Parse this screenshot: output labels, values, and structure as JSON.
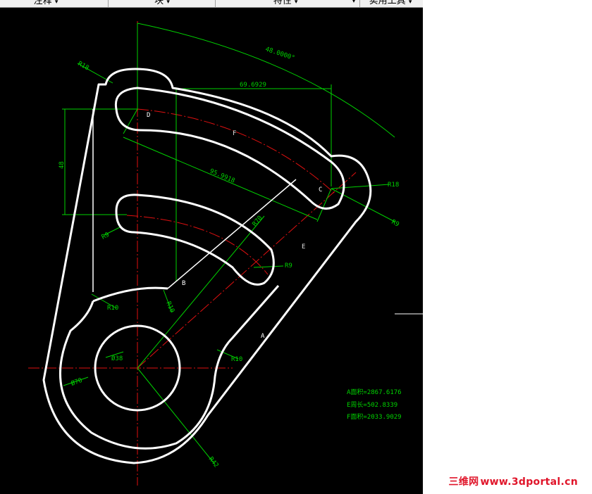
{
  "toolbar": {
    "items": [
      "注释",
      "块",
      "特性",
      "实用工具"
    ],
    "dropdown_glyph": "▾"
  },
  "drawing": {
    "points": {
      "a": "A",
      "b": "B",
      "c": "C",
      "d": "D",
      "e": "E",
      "f": "F"
    },
    "dims": {
      "angle": "48.0000°",
      "horiz": "69.6929",
      "vert": "48",
      "diag": "95.9918",
      "r18_top": "R18",
      "r18_right": "R18",
      "r9_right": "R9",
      "r9_left": "R9",
      "r9_slot": "R9",
      "r10_left": "R10",
      "r10_mid": "R10",
      "r10_right": "R10",
      "r70": "R70",
      "d38": "Ø38",
      "d70": "Ø70",
      "r42": "R42"
    },
    "results": {
      "a_area": "A面积=2867.6176",
      "e_length": "E周长=502.8339",
      "f_area": "F面积=2033.9029"
    }
  },
  "watermark": {
    "cn": "三维网",
    "url": "www.3dportal.cn"
  },
  "colors": {
    "canvas": "#000000",
    "outline": "#ffffff",
    "dimension": "#00d200",
    "centerline": "#e01010",
    "watermark": "#e0152a"
  }
}
